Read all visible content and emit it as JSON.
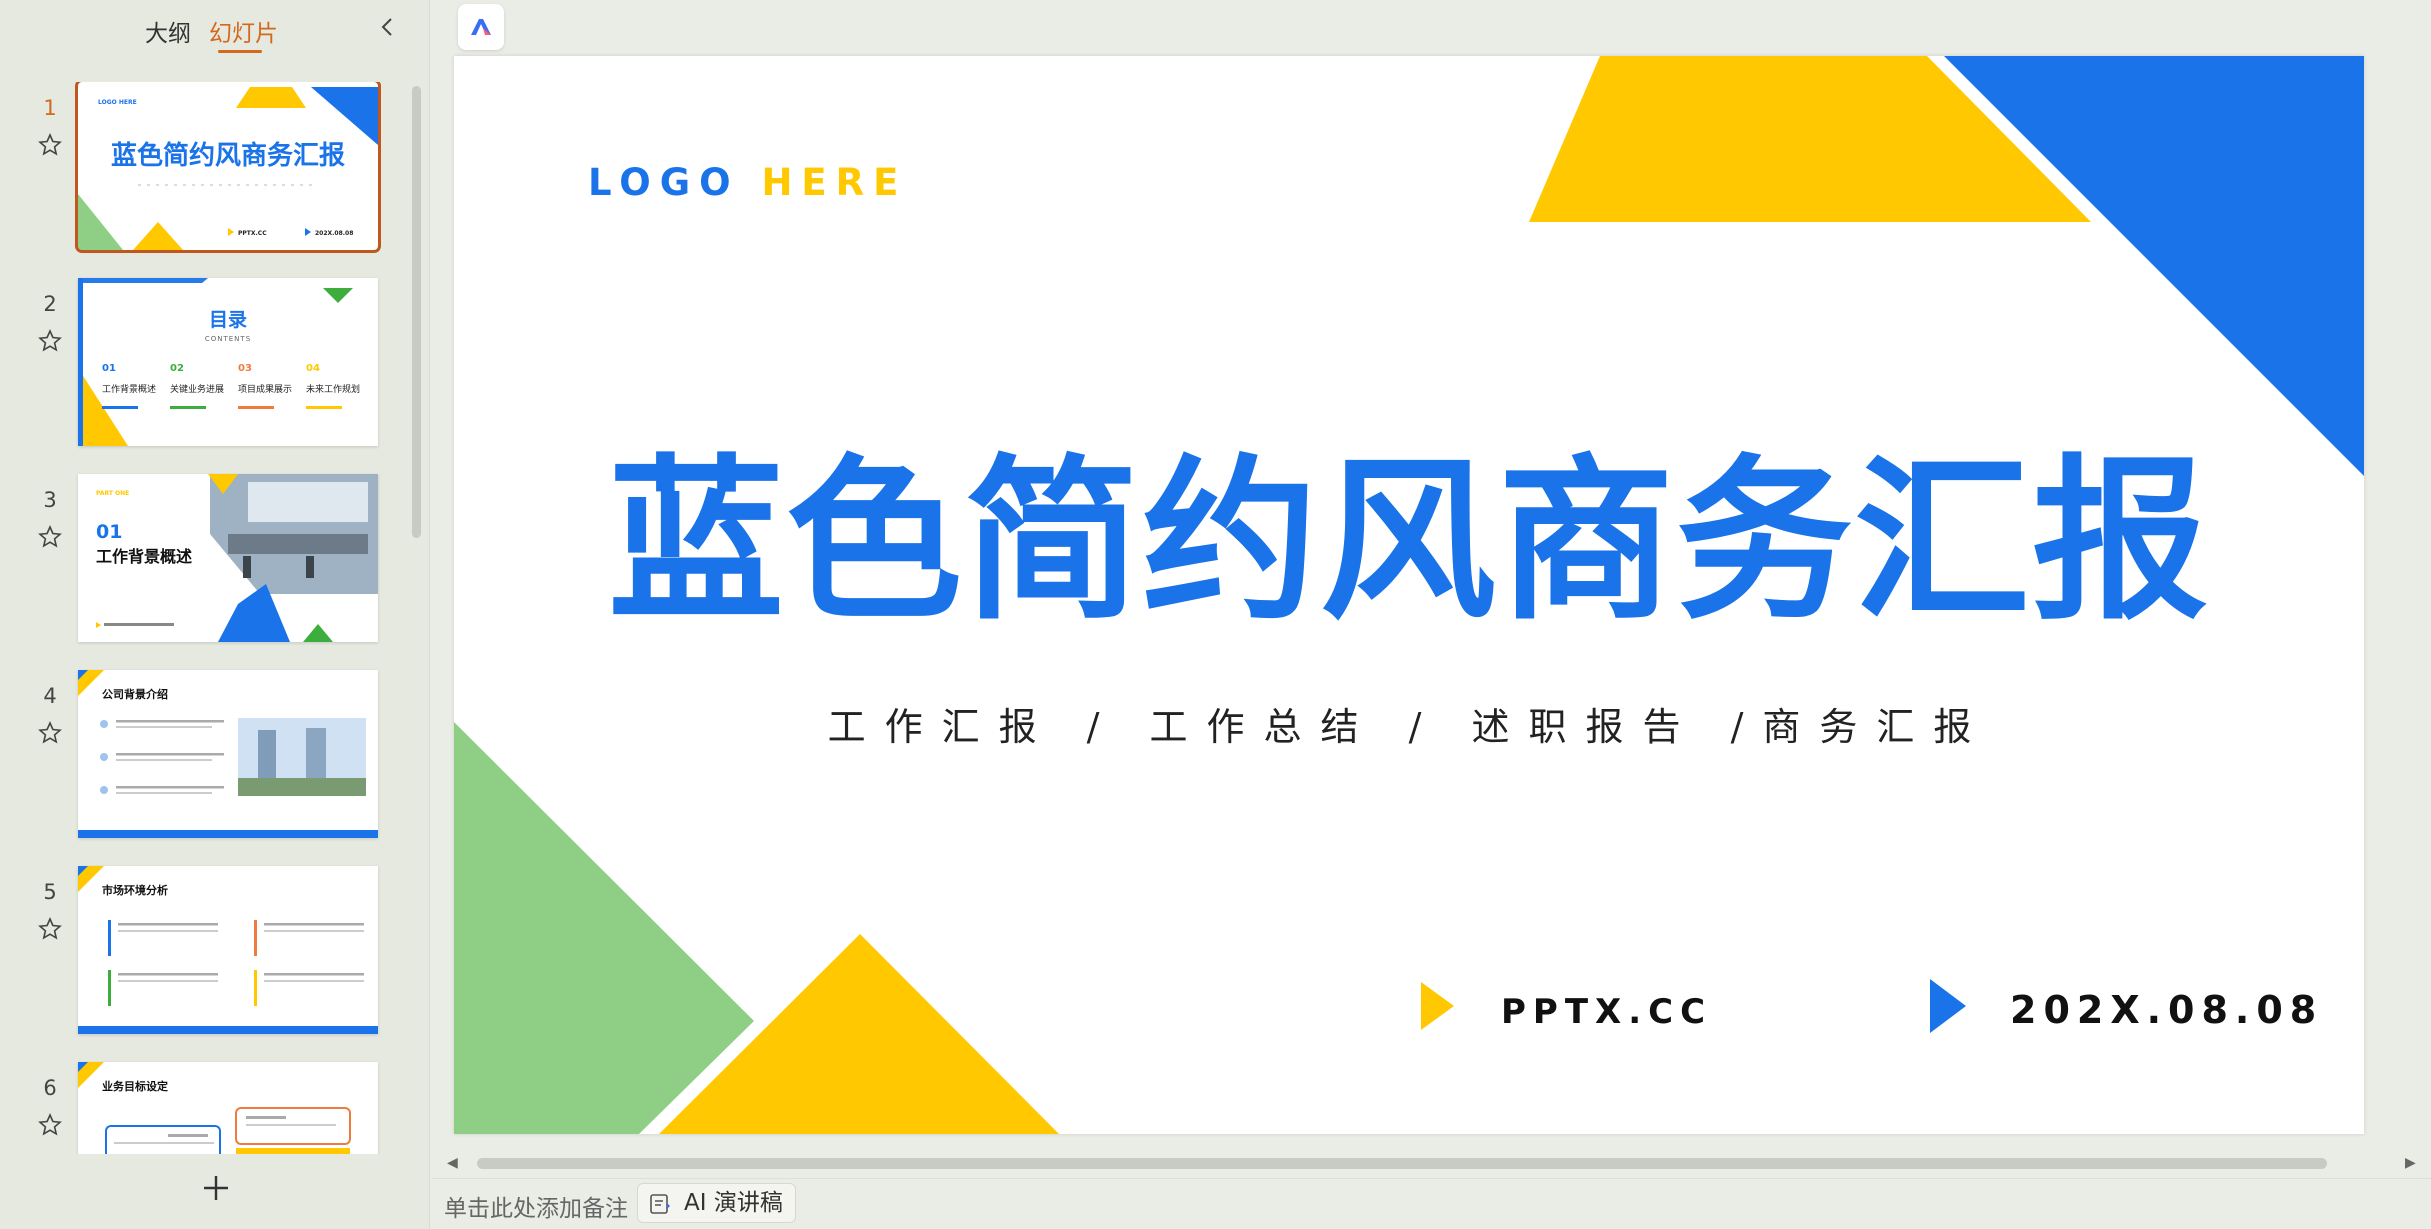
{
  "panel": {
    "tabs": [
      {
        "label": "大纲"
      },
      {
        "label": "幻灯片"
      }
    ],
    "active_tab": "幻灯片"
  },
  "thumbnails": [
    {
      "num": "1",
      "title": "蓝色简约风商务汇报",
      "logo": "LOGO HERE",
      "url": "PPTX.CC",
      "date": "202X.08.08"
    },
    {
      "num": "2",
      "title": "目录",
      "subtitle": "CONTENTS",
      "items": [
        {
          "n": "01",
          "label": "工作背景概述"
        },
        {
          "n": "02",
          "label": "关键业务进展"
        },
        {
          "n": "03",
          "label": "项目成果展示"
        },
        {
          "n": "04",
          "label": "未来工作规划"
        }
      ]
    },
    {
      "num": "3",
      "part": "PART ONE",
      "n": "01",
      "title": "工作背景概述"
    },
    {
      "num": "4",
      "title": "公司背景介绍"
    },
    {
      "num": "5",
      "title": "市场环境分析"
    },
    {
      "num": "6",
      "title": "业务目标设定"
    }
  ],
  "slide": {
    "logo_part1": "LOGO",
    "logo_part2": "HERE",
    "title": "蓝色简约风商务汇报",
    "subtitle": "工作汇报 / 工作总结 / 述职报告 /商务汇报",
    "url": "PPTX.CC",
    "date": "202X.08.08"
  },
  "notes": {
    "placeholder": "单击此处添加备注",
    "ai_button": "AI 演讲稿"
  },
  "colors": {
    "blue": "#1a73e8",
    "yellow": "#ffc800",
    "green": "#8ecf85",
    "accent_orange": "#d2691e"
  },
  "icons": {
    "collapse": "chevron-left-icon",
    "star": "star-outline-icon",
    "add": "plus-icon",
    "app": "app-logo-icon",
    "ai": "ai-notes-icon"
  }
}
